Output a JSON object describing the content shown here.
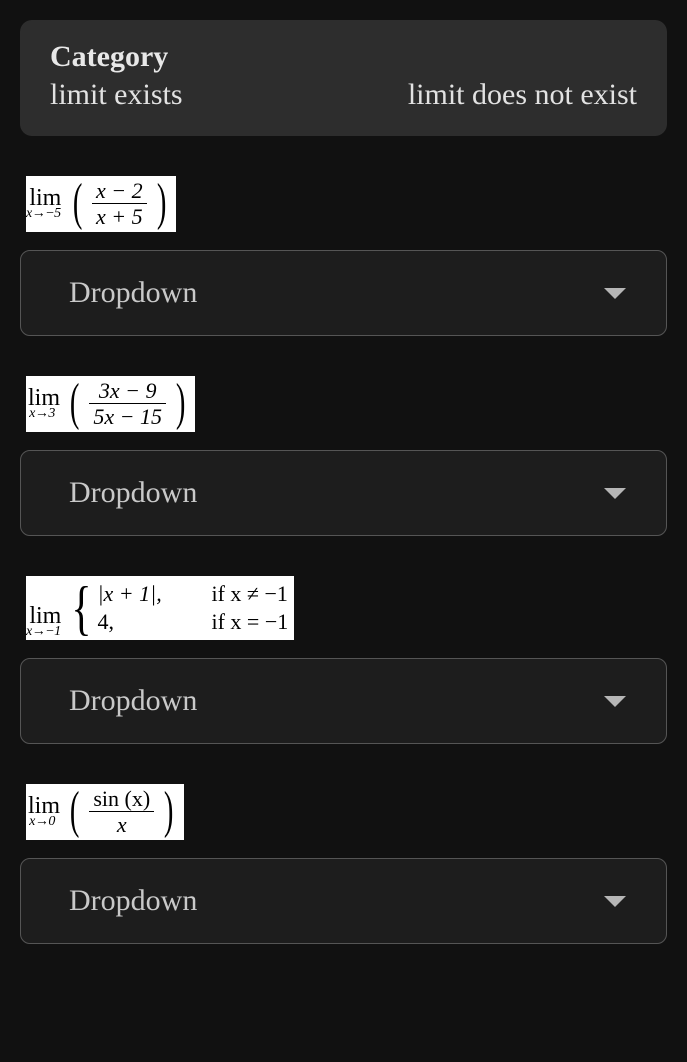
{
  "header": {
    "title": "Category",
    "left": "limit exists",
    "right": "limit does not exist"
  },
  "dropdown_placeholder": "Dropdown",
  "problems": [
    {
      "limit_label": "lim",
      "limit_sub": "x→−5",
      "kind": "frac_paren",
      "numerator": "x − 2",
      "denominator": "x + 5"
    },
    {
      "limit_label": "lim",
      "limit_sub": "x→3",
      "kind": "frac_paren",
      "numerator": "3x − 9",
      "denominator": "5x − 15"
    },
    {
      "limit_label": "lim",
      "limit_sub": "x→−1",
      "kind": "piecewise",
      "row1_expr": "|x + 1|,",
      "row1_cond": "if x ≠ −1",
      "row2_expr": "4,",
      "row2_cond": "if x = −1"
    },
    {
      "limit_label": "lim",
      "limit_sub": "x→0",
      "kind": "frac_paren",
      "numerator": "sin (x)",
      "denominator": "x"
    }
  ]
}
